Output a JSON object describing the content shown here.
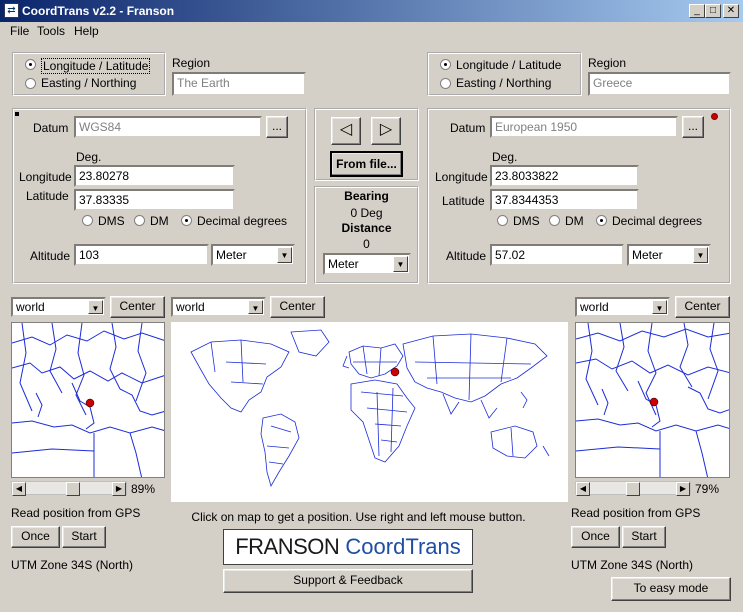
{
  "window": {
    "title": "CoordTrans v2.2 - Franson"
  },
  "menu": [
    "File",
    "Tools",
    "Help"
  ],
  "left": {
    "coord_mode": {
      "option1": "Longitude / Latitude",
      "option2": "Easting / Northing",
      "selected": "Longitude / Latitude"
    },
    "region_label": "Region",
    "region": "The Earth",
    "datum_label": "Datum",
    "datum": "WGS84",
    "browse": "...",
    "deg_label": "Deg.",
    "longitude_label": "Longitude",
    "longitude": "23.80278",
    "latitude_label": "Latitude",
    "latitude": "37.83335",
    "format": {
      "dms": "DMS",
      "dm": "DM",
      "dec": "Decimal degrees",
      "selected": "Decimal degrees"
    },
    "altitude_label": "Altitude",
    "altitude": "103",
    "unit": "Meter",
    "map_select": "world",
    "center": "Center",
    "zoom": "89%",
    "gps_label": "Read position from GPS",
    "once": "Once",
    "start": "Start",
    "utm": "UTM Zone 34S (North)"
  },
  "middle": {
    "convert_left": "◁",
    "convert_right": "▷",
    "from_file": "From file...",
    "bearing_label": "Bearing",
    "bearing": "0 Deg",
    "distance_label": "Distance",
    "distance": "0",
    "unit": "Meter",
    "map_select": "world",
    "center": "Center",
    "hint": "Click on map to get a position. Use right and left mouse button.",
    "logo_a": "FRANSON",
    "logo_b": "CoordTrans",
    "support": "Support & Feedback"
  },
  "right": {
    "coord_mode": {
      "option1": "Longitude / Latitude",
      "option2": "Easting / Northing",
      "selected": "Longitude / Latitude"
    },
    "region_label": "Region",
    "region": "Greece",
    "datum_label": "Datum",
    "datum": "European 1950",
    "browse": "...",
    "deg_label": "Deg.",
    "longitude_label": "Longitude",
    "longitude": "23.8033822",
    "latitude_label": "Latitude",
    "latitude": "37.8344353",
    "format": {
      "dms": "DMS",
      "dm": "DM",
      "dec": "Decimal degrees",
      "selected": "Decimal degrees"
    },
    "altitude_label": "Altitude",
    "altitude": "57.02",
    "unit": "Meter",
    "map_select": "world",
    "center": "Center",
    "zoom": "79%",
    "gps_label": "Read position from GPS",
    "once": "Once",
    "start": "Start",
    "utm": "UTM Zone 34S (North)",
    "easy_mode": "To easy mode"
  },
  "colors": {
    "title_start": "#0a246a",
    "title_end": "#a6caf0",
    "map_lines": "#1c2cd8",
    "marker": "#cc0000"
  }
}
